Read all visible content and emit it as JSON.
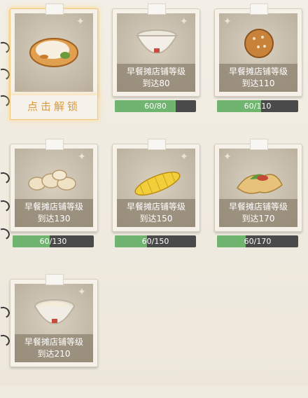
{
  "cards": [
    {
      "item": "dumpling-food",
      "unlock_label": "点击解锁"
    },
    {
      "item": "soymilk-bowl",
      "req": "早餐摊店铺等级",
      "req2": "到达80",
      "progress_text": "60/80",
      "progress": 0.75
    },
    {
      "item": "sesame-ball",
      "req": "早餐摊店铺等级",
      "req2": "到达110",
      "progress_text": "60/110",
      "progress": 0.545
    },
    {
      "item": "steamed-buns",
      "req": "早餐摊店铺等级",
      "req2": "到达130",
      "progress_text": "60/130",
      "progress": 0.46
    },
    {
      "item": "corn-cob",
      "req": "早餐摊店铺等级",
      "req2": "到达150",
      "progress_text": "60/150",
      "progress": 0.4
    },
    {
      "item": "wrap-roll",
      "req": "早餐摊店铺等级",
      "req2": "到达170",
      "progress_text": "60/170",
      "progress": 0.353
    },
    {
      "item": "soup-bowl",
      "req": "早餐摊店铺等级",
      "req2": "到达210"
    }
  ],
  "colors": {
    "progress_fill": "#6fb46f",
    "progress_bg": "#4a4a4a",
    "unlock_glow": "#f0c97a"
  }
}
